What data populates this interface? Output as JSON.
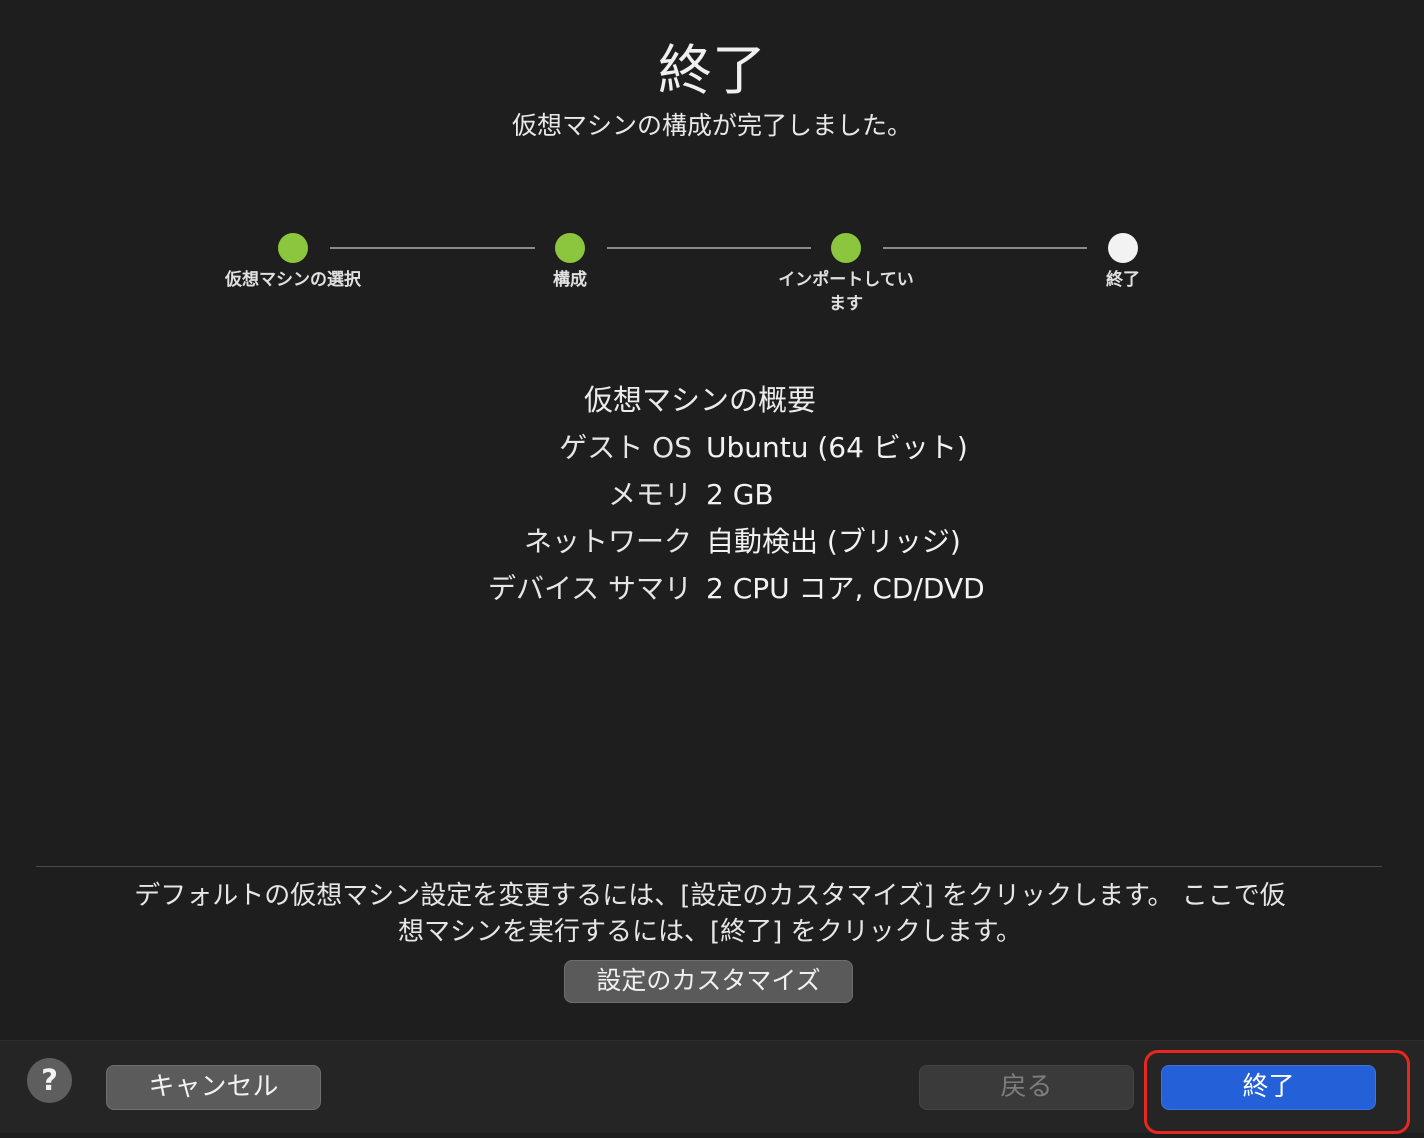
{
  "header": {
    "title": "終了",
    "subtitle": "仮想マシンの構成が完了しました。"
  },
  "stepper": {
    "steps": [
      {
        "label": "仮想マシンの選択",
        "status": "done"
      },
      {
        "label": "構成",
        "status": "done"
      },
      {
        "label": "インポートしてい\nます",
        "status": "done"
      },
      {
        "label": "終了",
        "status": "current"
      }
    ]
  },
  "summary": {
    "title": "仮想マシンの概要",
    "rows": [
      {
        "key": "ゲスト OS",
        "value": "Ubuntu (64 ビット)"
      },
      {
        "key": "メモリ",
        "value": "2 GB"
      },
      {
        "key": "ネットワーク",
        "value": "自動検出 (ブリッジ)"
      },
      {
        "key": "デバイス サマリ",
        "value": "2 CPU コア, CD/DVD"
      }
    ]
  },
  "footer": {
    "info_line1": "デフォルトの仮想マシン設定を変更するには、[設定のカスタマイズ] をクリックします。 ここで仮",
    "info_line2": "想マシンを実行するには、[終了] をクリックします。",
    "customize_label": "設定のカスタマイズ"
  },
  "bottom_bar": {
    "help_label": "?",
    "cancel_label": "キャンセル",
    "back_label": "戻る",
    "finish_label": "終了"
  },
  "colors": {
    "step_done": "#8cc63f",
    "step_current": "#f2f2f2",
    "finish_button": "#2460d8",
    "highlight": "#e8281f"
  }
}
